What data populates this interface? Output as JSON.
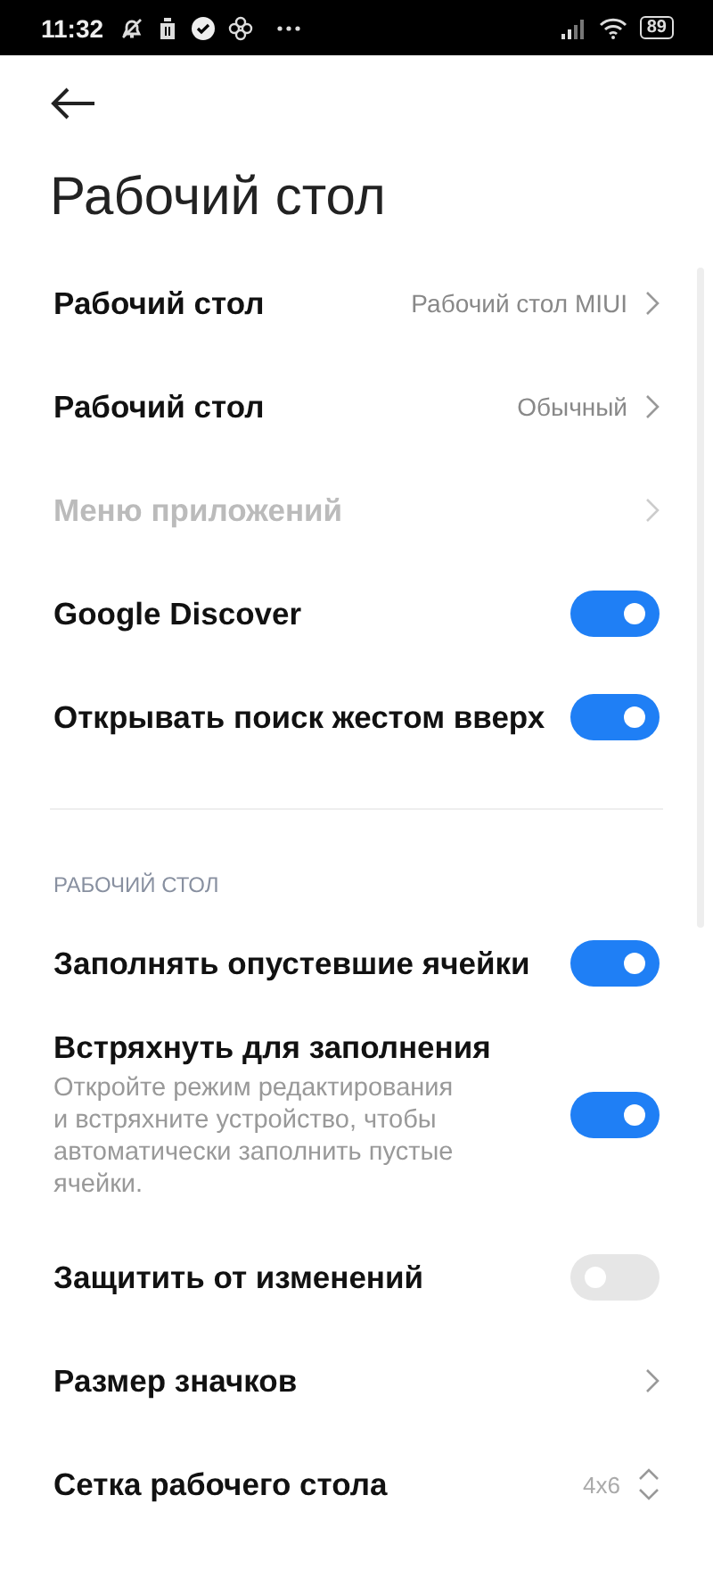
{
  "status_bar": {
    "time": "11:32",
    "battery": "89"
  },
  "title": "Рабочий стол",
  "items": [
    {
      "kind": "link",
      "label": "Рабочий стол",
      "value": "Рабочий стол MIUI",
      "disabled": false
    },
    {
      "kind": "link",
      "label": "Рабочий стол",
      "value": "Обычный",
      "disabled": false
    },
    {
      "kind": "link",
      "label": "Меню приложений",
      "disabled": true
    },
    {
      "kind": "toggle",
      "label": "Google Discover",
      "on": true
    },
    {
      "kind": "toggle",
      "label": "Открывать поиск жестом вверх",
      "on": true
    },
    {
      "kind": "divider"
    },
    {
      "kind": "header",
      "label": "РАБОЧИЙ СТОЛ"
    },
    {
      "kind": "toggle",
      "label": "Заполнять опустевшие ячейки",
      "on": true
    },
    {
      "kind": "toggle",
      "label": "Встряхнуть для заполнения",
      "description": "Откройте режим редактирования и встряхните устройство, чтобы автоматически заполнить пустые ячейки.",
      "on": true
    },
    {
      "kind": "toggle",
      "label": "Защитить от изменений",
      "on": false
    },
    {
      "kind": "link",
      "label": "Размер значков",
      "disabled": false
    },
    {
      "kind": "stepper",
      "label": "Сетка рабочего стола",
      "value": "4x6"
    }
  ]
}
